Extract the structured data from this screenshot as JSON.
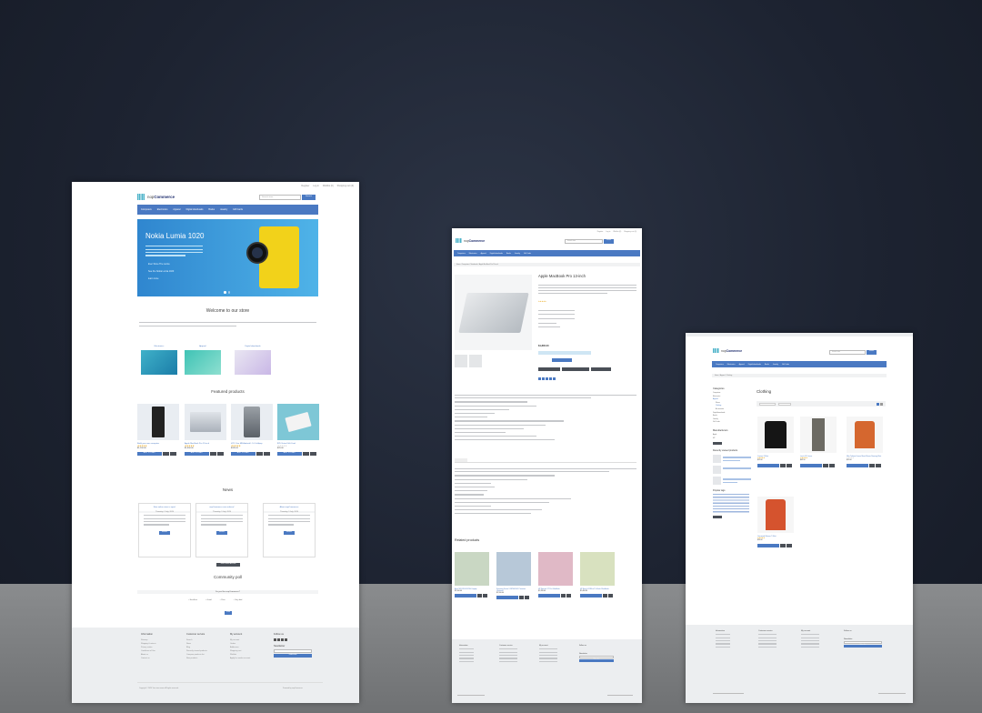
{
  "common": {
    "logo_brand": "nop",
    "logo_name": "Commerce",
    "header_links": [
      "Register",
      "Log in",
      "Wishlist (0)",
      "Shopping cart (0)"
    ],
    "search_placeholder": "Search store",
    "search_button": "Search",
    "menu": [
      "Computers",
      "Electronics",
      "Apparel",
      "Digital downloads",
      "Books",
      "Jewelry",
      "Gift Cards"
    ],
    "footer_cols": [
      {
        "title": "Information",
        "links": [
          "Sitemap",
          "Shipping & returns",
          "Privacy notice",
          "Conditions of Use",
          "About us",
          "Contact us"
        ]
      },
      {
        "title": "Customer service",
        "links": [
          "Search",
          "News",
          "Blog",
          "Recently viewed products",
          "Compare products list",
          "New products"
        ]
      },
      {
        "title": "My account",
        "links": [
          "My account",
          "Orders",
          "Addresses",
          "Shopping cart",
          "Wishlist",
          "Apply for vendor account"
        ]
      },
      {
        "title": "Follow us",
        "links": []
      }
    ],
    "newsletter_title": "Newsletter",
    "newsletter_button": "Subscribe",
    "powered_by": "Powered by nopCommerce",
    "copyright": "Copyright © 2020 Your store name. All rights reserved."
  },
  "home": {
    "slider_title": "Nokia Lumia 1020",
    "slider_lines": [
      "Ever Since The Lumia",
      "See the Nokia Lumia 1020",
      "learn more"
    ],
    "welcome_title": "Welcome to our store",
    "categories": [
      "Electronics",
      "Apparel",
      "Digital downloads"
    ],
    "featured_title": "Featured products",
    "featured": [
      {
        "name": "Build your own computer",
        "price": "$1,200.00"
      },
      {
        "name": "Apple MacBook Pro 13-inch",
        "price": "$1,800.00"
      },
      {
        "name": "HTC One M8 Android L 5.0 Lollipop",
        "price": "$245.00"
      },
      {
        "name": "$25 Virtual Gift Card",
        "price": "$25.00"
      }
    ],
    "add_to_cart": "ADD TO CART",
    "news_title": "News",
    "news": [
      {
        "title": "New online store is open!",
        "date": "Thursday, 9 July, 2020",
        "button": "details"
      },
      {
        "title": "nopCommerce new release!",
        "date": "Thursday, 9 July, 2020",
        "button": "details"
      },
      {
        "title": "About nopCommerce",
        "date": "Thursday, 9 July, 2020",
        "button": "details"
      }
    ],
    "news_archive": "View News Archive",
    "poll_title": "Community poll",
    "poll_question": "Do you like nopCommerce?",
    "poll_options": [
      "Excellent",
      "Good",
      "Poor",
      "Very bad"
    ],
    "vote_button": "Vote"
  },
  "product": {
    "breadcrumb": "Home / Computers / Notebooks / Apple MacBook Pro 13-inch",
    "name": "Apple MacBook Pro 13-inch",
    "price": "$1,800.00",
    "add_to_cart": "ADD TO CART",
    "related_title": "Related products",
    "related": [
      {
        "name": "Asus N551JK-XO076H Laptop",
        "price": "$1,500.00"
      },
      {
        "name": "Samsung Series 9 NP900X4C Premium Ultrabook",
        "price": "$1,590.00"
      },
      {
        "name": "HP Spectre XT Pro UltraBook",
        "price": "$1,350.00"
      },
      {
        "name": "HP Envy 6-1180ca 15.6-Inch Sleekbook",
        "price": "$1,460.00"
      }
    ]
  },
  "category": {
    "breadcrumb": "Home / Apparel / Clothing",
    "page_title": "Clothing",
    "sidebar_categories_title": "Categories",
    "sidebar_categories": [
      "Computers",
      "Electronics",
      "Apparel",
      "Shoes",
      "Clothing",
      "Accessories",
      "Digital downloads",
      "Books",
      "Jewelry",
      "Gift Cards"
    ],
    "manufacturers_title": "Manufacturers",
    "manufacturers": [
      "Apple",
      "HP"
    ],
    "recent_title": "Recently viewed products",
    "tags_title": "Popular tags",
    "products": [
      {
        "name": "Custom T-Shirt",
        "price": "$15.00"
      },
      {
        "name": "Levi's 511 Jeans",
        "price": "$43.50"
      },
      {
        "name": "Nike Tailwind Loose Short-Sleeve Running Shirt",
        "price": "$15.00"
      },
      {
        "name": "Oversized Women T-Shirt",
        "price": "$24.00"
      }
    ]
  },
  "colors": {
    "accent": "#4a79c2",
    "dark_button": "#4a4f57",
    "footer": "#eceef0",
    "stars": "#e8a20c"
  }
}
